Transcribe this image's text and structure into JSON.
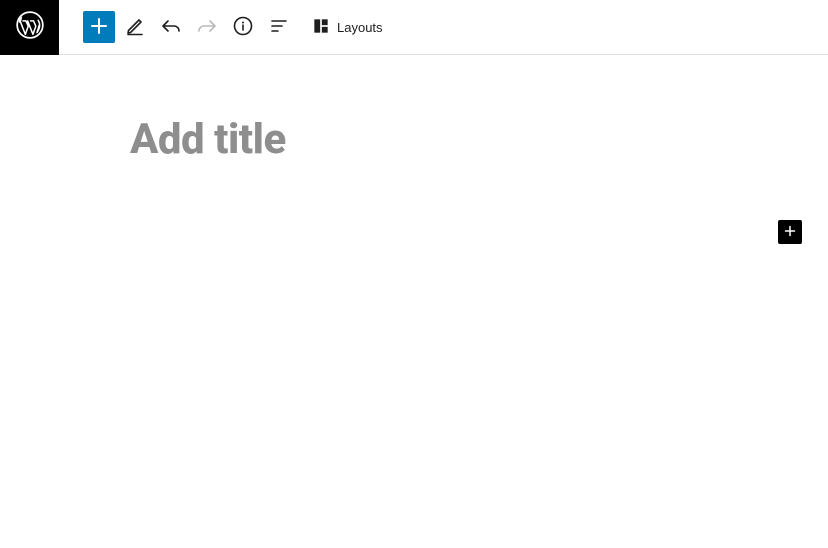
{
  "toolbar": {
    "layouts_label": "Layouts"
  },
  "editor": {
    "title_value": "",
    "title_placeholder": "Add title"
  }
}
